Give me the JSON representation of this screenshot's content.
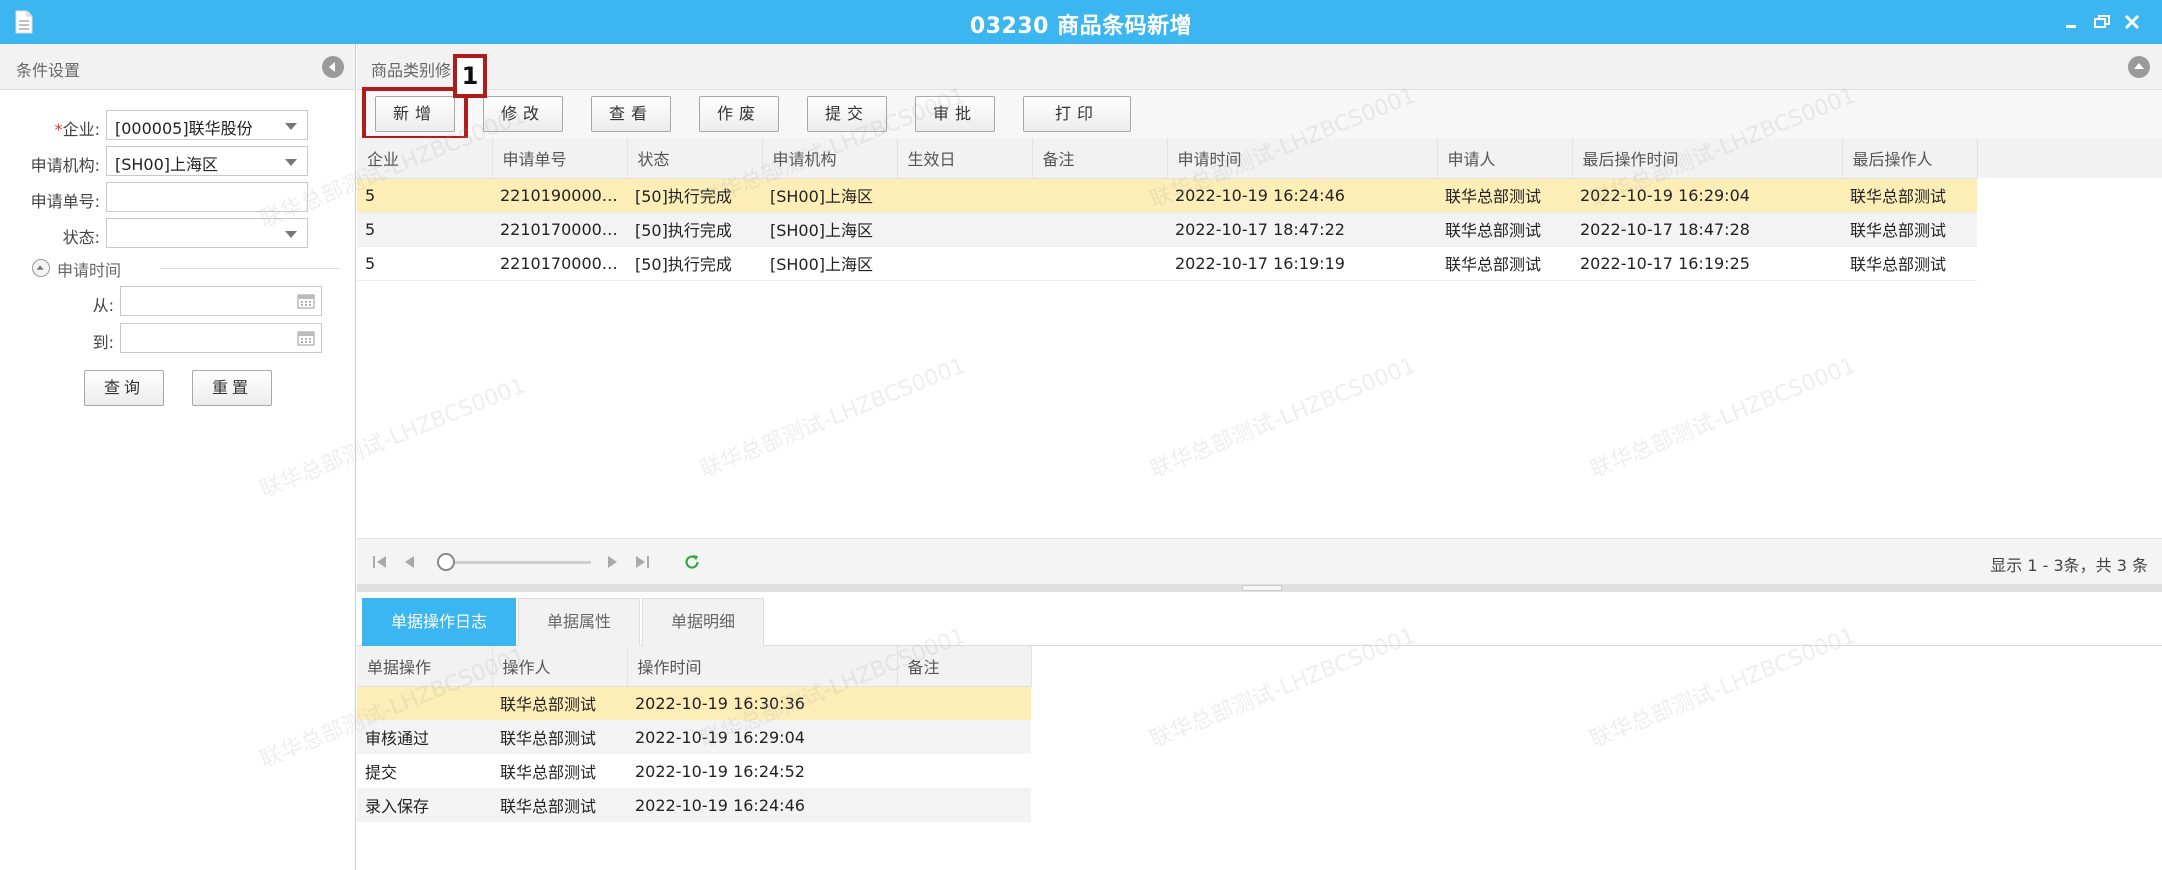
{
  "window": {
    "title": "03230 商品条码新增",
    "accent": "#3bb6f0"
  },
  "left_panel": {
    "title": "条件设置",
    "fields": {
      "company_label": "企业:",
      "company_required": "*",
      "company_value": "[000005]联华股份",
      "org_label": "申请机构:",
      "org_value": "[SH00]上海区",
      "apply_no_label": "申请单号:",
      "apply_no_value": "",
      "status_label": "状态:",
      "status_value": ""
    },
    "date_group": {
      "title": "申请时间",
      "from_label": "从:",
      "to_label": "到:"
    },
    "query_button": "查询",
    "reset_button": "重置"
  },
  "main": {
    "tab_title": "商品类别修",
    "toolbar": {
      "add": "新增",
      "edit": "修改",
      "view": "查看",
      "void": "作废",
      "submit": "提交",
      "approve": "审批",
      "print": "打印"
    },
    "callout_number": "1",
    "grid": {
      "columns": [
        "企业",
        "申请单号",
        "状态",
        "申请机构",
        "生效日",
        "备注",
        "申请时间",
        "申请人",
        "最后操作时间",
        "最后操作人"
      ],
      "rows": [
        [
          "5",
          "22101900000...",
          "[50]执行完成",
          "[SH00]上海区",
          "",
          "",
          "2022-10-19 16:24:46",
          "联华总部测试",
          "2022-10-19 16:29:04",
          "联华总部测试"
        ],
        [
          "5",
          "22101700000...",
          "[50]执行完成",
          "[SH00]上海区",
          "",
          "",
          "2022-10-17 18:47:22",
          "联华总部测试",
          "2022-10-17 18:47:28",
          "联华总部测试"
        ],
        [
          "5",
          "22101700000...",
          "[50]执行完成",
          "[SH00]上海区",
          "",
          "",
          "2022-10-17 16:19:19",
          "联华总部测试",
          "2022-10-17 16:19:25",
          "联华总部测试"
        ]
      ]
    },
    "pager": {
      "info": "显示 1 - 3条，共 3 条"
    },
    "bottom_tabs": [
      "单据操作日志",
      "单据属性",
      "单据明细"
    ],
    "log": {
      "columns": [
        "单据操作",
        "操作人",
        "操作时间",
        "备注"
      ],
      "rows": [
        [
          "",
          "联华总部测试",
          "2022-10-19 16:30:36",
          ""
        ],
        [
          "审核通过",
          "联华总部测试",
          "2022-10-19 16:29:04",
          ""
        ],
        [
          "提交",
          "联华总部测试",
          "2022-10-19 16:24:52",
          ""
        ],
        [
          "录入保存",
          "联华总部测试",
          "2022-10-19 16:24:46",
          ""
        ]
      ]
    }
  },
  "watermark": "联华总部测试-LHZBCS0001"
}
